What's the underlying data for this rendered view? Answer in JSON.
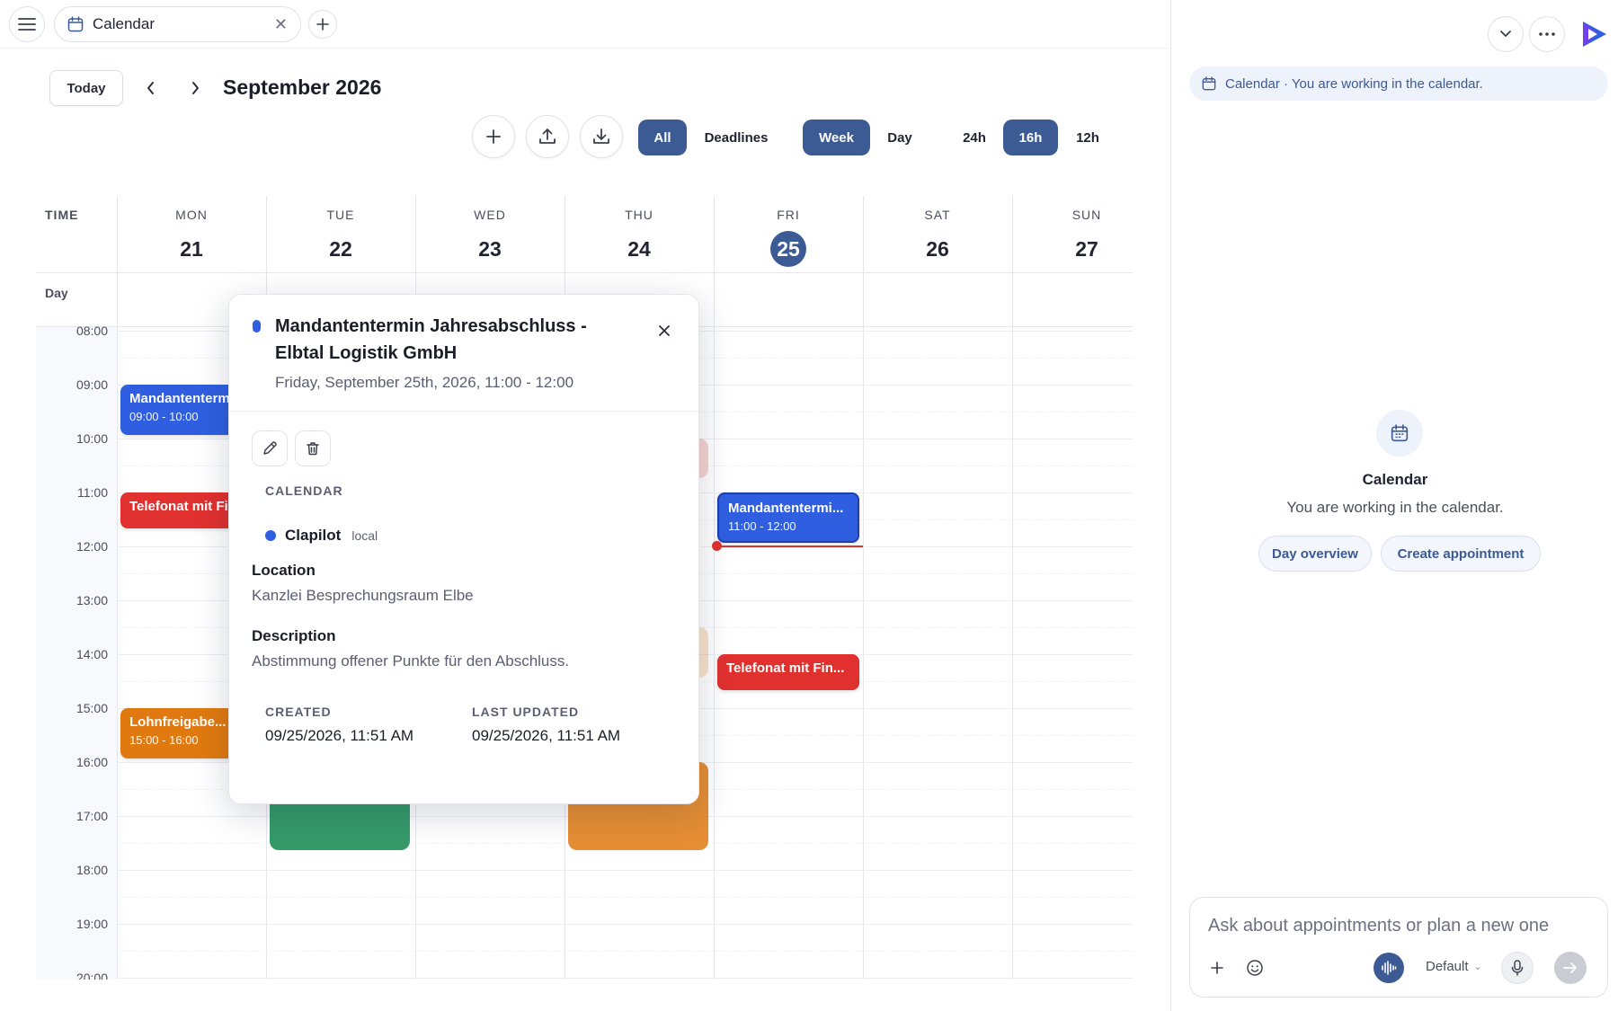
{
  "tab": {
    "title": "Calendar"
  },
  "toolbar": {
    "today_label": "Today",
    "month_title": "September 2026",
    "filter_all": "All",
    "filter_deadlines": "Deadlines",
    "view_week": "Week",
    "view_day": "Day",
    "range_24h": "24h",
    "range_16h": "16h",
    "range_12h": "12h",
    "active_filter": "All",
    "active_view": "Week",
    "active_range": "16h"
  },
  "grid": {
    "time_header": "TIME",
    "allday_label": "Day",
    "days": [
      {
        "name": "MON",
        "num": "21"
      },
      {
        "name": "TUE",
        "num": "22"
      },
      {
        "name": "WED",
        "num": "23"
      },
      {
        "name": "THU",
        "num": "24"
      },
      {
        "name": "FRI",
        "num": "25",
        "today": true
      },
      {
        "name": "SAT",
        "num": "26"
      },
      {
        "name": "SUN",
        "num": "27"
      }
    ],
    "hours": [
      "08:00",
      "09:00",
      "10:00",
      "11:00",
      "12:00",
      "13:00",
      "14:00",
      "15:00",
      "16:00",
      "17:00",
      "18:00",
      "19:00",
      "20:00"
    ]
  },
  "events": [
    {
      "title": "Mandantentermin Jahresabschluss",
      "time": "09:00 - 10:00",
      "color": "#2f5fe0"
    },
    {
      "title": "Telefonat mit Finanzamt",
      "time": "",
      "color": "#e0312f"
    },
    {
      "title": "Lohnfreigabe...",
      "time": "15:00 - 16:00",
      "color": "#e07a10"
    },
    {
      "title": "Mandantentermi...",
      "time": "11:00 - 12:00",
      "color": "#2f5fe0"
    },
    {
      "title": "Telefonat mit Fin...",
      "time": "",
      "color": "#e0312f"
    }
  ],
  "popover": {
    "title": "Mandantentermin Jahresabschluss - Elbtal Logistik GmbH",
    "when": "Friday, September 25th, 2026, 11:00 - 12:00",
    "calendar_caption": "CALENDAR",
    "calendar_name": "Clapilot",
    "calendar_tag": "local",
    "location_heading": "Location",
    "location_value": "Kanzlei Besprechungsraum Elbe",
    "description_heading": "Description",
    "description_value": "Abstimmung offener Punkte für den Abschluss.",
    "created_caption": "CREATED",
    "created_value": "09/25/2026, 11:51 AM",
    "updated_caption": "LAST UPDATED",
    "updated_value": "09/25/2026, 11:51 AM"
  },
  "panel": {
    "context_text": "Calendar · You are working in the calendar.",
    "empty_title": "Calendar",
    "empty_subtitle": "You are working in the calendar.",
    "chip_day_overview": "Day overview",
    "chip_create": "Create appointment",
    "composer_placeholder": "Ask about appointments or plan a new one",
    "model_label": "Default"
  },
  "colors": {
    "accent": "#3c5a93",
    "event_blue": "#2f5fe0",
    "event_red": "#e0312f",
    "event_orange": "#e07a10",
    "event_green": "#1f8f5a"
  },
  "icons": {
    "menu": "hamburger-icon",
    "tab": "calendar-icon",
    "tab_close": "close-icon",
    "new_tab": "plus-icon",
    "prev": "chevron-left-icon",
    "next": "chevron-right-icon",
    "add": "plus-icon",
    "upload": "upload-icon",
    "download": "download-icon",
    "edit": "pencil-icon",
    "delete": "trash-icon",
    "collapse": "chevron-down-icon",
    "more": "more-horizontal-icon",
    "voice": "waveform-icon",
    "mic": "microphone-icon",
    "send": "arrow-right-icon",
    "emoji": "smiley-icon"
  }
}
